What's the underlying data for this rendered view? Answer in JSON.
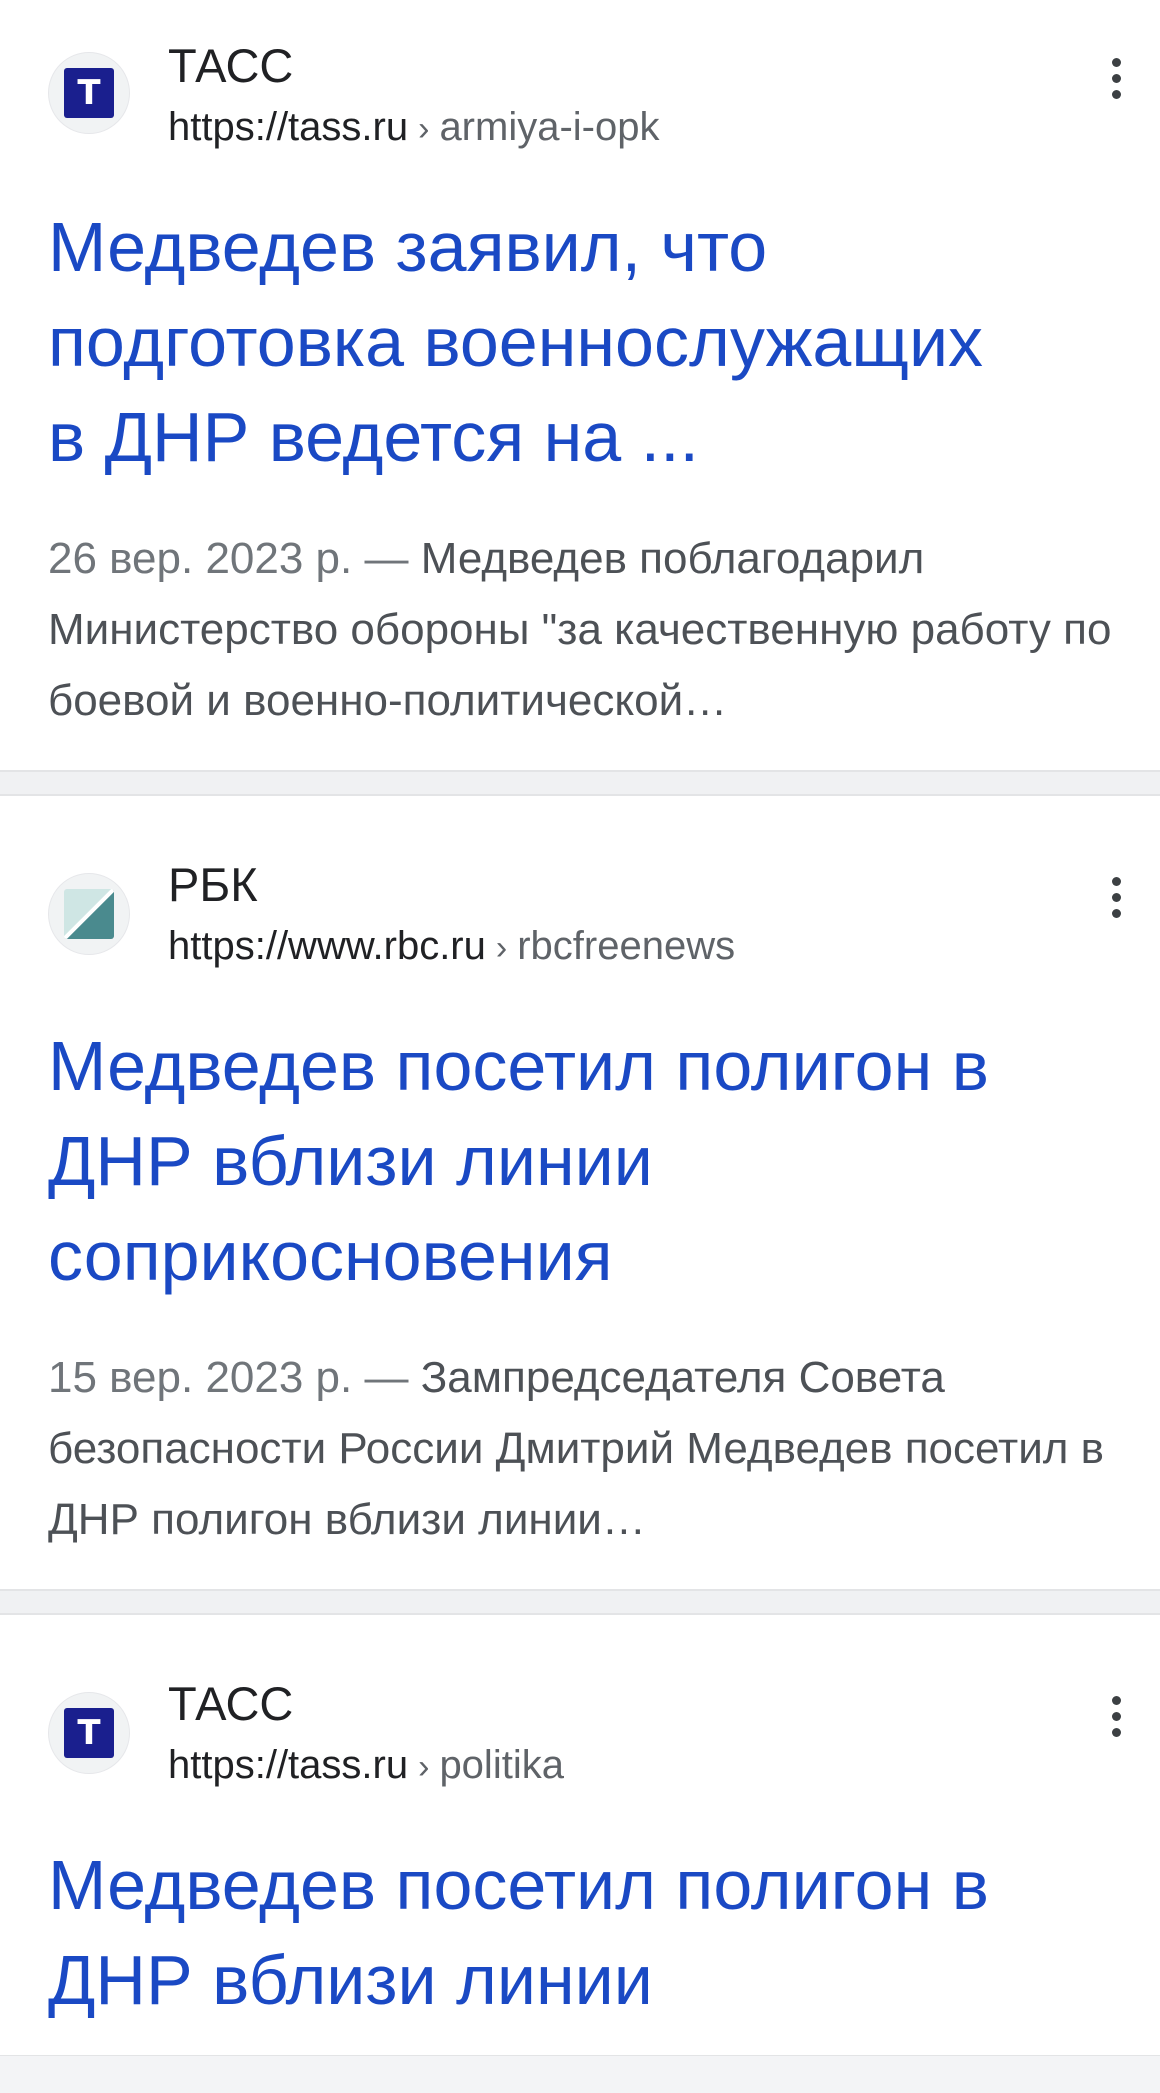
{
  "results": [
    {
      "site_name": "ТАСС",
      "url_host": "https://tass.ru",
      "url_separator": "›",
      "url_path": "armiya-i-opk",
      "favicon_letter": "Т",
      "title_lines": [
        "Медведев заявил, что",
        "подготовка военнослужащих",
        "в ДНР ведется на ..."
      ],
      "date": "26 вер. 2023 р.",
      "dash": "—",
      "snippet": "Медведев поблагодарил Министерство обороны \"за качественную работу по боевой и военно-политической…"
    },
    {
      "site_name": "РБК",
      "url_host": "https://www.rbc.ru",
      "url_separator": "›",
      "url_path": "rbcfreenews",
      "title_lines": [
        "Медведев посетил полигон в",
        "ДНР вблизи линии",
        "соприкосновения"
      ],
      "date": "15 вер. 2023 р.",
      "dash": "—",
      "snippet": "Зампредседателя Совета безопасности России Дмитрий Медведев посетил в ДНР полигон вблизи линии…"
    },
    {
      "site_name": "ТАСС",
      "url_host": "https://tass.ru",
      "url_separator": "›",
      "url_path": "politika",
      "favicon_letter": "Т",
      "title_lines": [
        "Медведев посетил полигон в",
        "ДНР вблизи линии"
      ]
    }
  ],
  "colors": {
    "title_link": "#1a49c4",
    "tass_brand": "#1a1f8e",
    "rbc_teal": "#4a8a8e",
    "rbc_light": "#cfe6e4"
  },
  "icons": [
    "tass-logo-icon",
    "rbc-logo-icon",
    "more-vert-icon"
  ]
}
